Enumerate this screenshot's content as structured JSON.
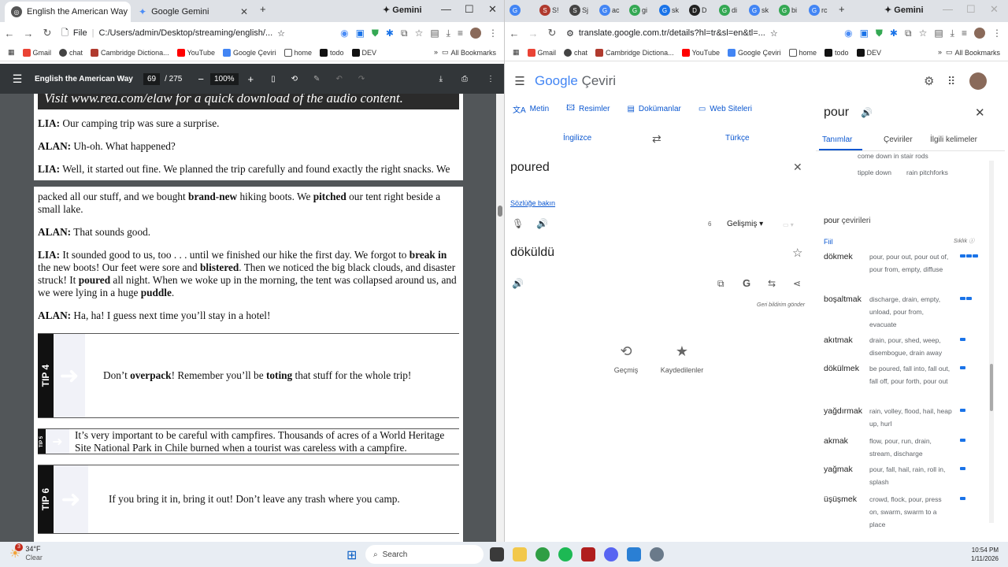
{
  "left_window": {
    "tabs": [
      {
        "label": "English the American Way",
        "active": true
      },
      {
        "label": "Google Gemini",
        "active": false
      }
    ],
    "gemini_label": "Gemini",
    "address": {
      "scheme": "File",
      "url": "C:/Users/admin/Desktop/streaming/english/..."
    },
    "bookmarks": [
      "Gmail",
      "chat",
      "Cambridge Dictiona...",
      "YouTube",
      "Google Çeviri",
      "home",
      "todo",
      "DEV"
    ],
    "all_bookmarks": "All Bookmarks",
    "pdf": {
      "title": "English the American Way",
      "page": "69",
      "total": "/ 275",
      "zoom": "100%",
      "header_strip": "Visit www.rea.com/elaw for a quick download of the audio content.",
      "top_lines": [
        {
          "speaker": "LIA:",
          "text": " Our camping trip was sure a surprise."
        },
        {
          "speaker": "ALAN:",
          "text": " Uh-oh. What happened?"
        },
        {
          "speaker": "LIA:",
          "text": " Well, it started out fine. We planned the trip carefully and found exactly the right snacks. We"
        }
      ],
      "para1": {
        "a": "packed all our stuff, and we bought ",
        "b1": "brand-new",
        "c": " hiking boots. We ",
        "b2": "pitched",
        "d": " our tent right beside a small lake."
      },
      "alan2": {
        "speaker": "ALAN:",
        "text": " That sounds good."
      },
      "para2": {
        "speaker": "LIA:",
        "a": " It sounded good to us, too . . . until we finished our hike the first day. We forgot to ",
        "b1": "break in",
        "c": " the new boots! Our feet were sore and ",
        "b2": "blistered",
        "d": ". Then we noticed the big black clouds, and disaster struck! It ",
        "b3": "poured",
        "e": " all night. When we woke up in the morning, the tent was collapsed around us, and we were lying in a huge ",
        "b4": "puddle",
        "f": "."
      },
      "alan3": {
        "speaker": "ALAN:",
        "text": " Ha, ha! I guess next time you’ll stay in a hotel!"
      },
      "tip4": {
        "label": "TIP 4",
        "a": "Don’t ",
        "b1": "overpack",
        "c": "! Remember you’ll be ",
        "b2": "toting",
        "d": " that stuff for the whole trip!"
      },
      "tip5": {
        "label": "TIP 5",
        "text": "It’s very important to be careful with campfires. Thousands of acres of a World Heritage Site National Park in Chile burned when a tourist was careless with a campfire."
      },
      "tip6": {
        "label": "TIP 6",
        "text": "If you bring it in, bring it out! Don’t leave any trash where you camp."
      }
    }
  },
  "right_window": {
    "tab_letters": [
      "G",
      "S",
      "S",
      "G",
      "G",
      "G",
      "D",
      "G",
      "G",
      "G",
      "G"
    ],
    "tab_abbrevs": [
      "",
      "S!",
      "Sj",
      "ac",
      "gi",
      "sk",
      "D",
      "di",
      "sk",
      "bi",
      "rc"
    ],
    "gemini_label": "Gemini",
    "address": {
      "url": "translate.google.com.tr/details?hl=tr&sl=en&tl=..."
    },
    "bookmarks": [
      "Gmail",
      "chat",
      "Cambridge Dictiona...",
      "YouTube",
      "Google Çeviri",
      "home",
      "todo",
      "DEV"
    ],
    "all_bookmarks": "All Bookmarks",
    "translate": {
      "logo_google": "Google",
      "logo_ceviri": "Çeviri",
      "modes": [
        "Metin",
        "Resimler",
        "Dokümanlar",
        "Web Siteleri"
      ],
      "source_lang": "İngilizce",
      "target_lang": "Türkçe",
      "source_text": "poured",
      "dictionary_link": "Sözlüğe bakın",
      "char_count": "6",
      "advanced": "Gelişmiş",
      "target_text": "döküldü",
      "feedback": "Geri bildirim gönder",
      "history": "Geçmiş",
      "saved": "Kaydedilenler"
    },
    "side": {
      "word": "pour",
      "tabs": [
        "Tanımlar",
        "Çeviriler",
        "İlgili kelimeler"
      ],
      "related_row1": "come down in stair rods",
      "related_row2a": "tipple down",
      "related_row2b": "rain pitchforks",
      "translations_title_word": "pour",
      "translations_title_rest": " çevirileri",
      "pos": "Fiil",
      "freq_label": "Sıklık",
      "entries": [
        {
          "word": "dökmek",
          "syn": "pour, pour out, pour out of, pour from, empty, diffuse",
          "freq": 3
        },
        {
          "word": "boşaltmak",
          "syn": "discharge, drain, empty, unload, pour from, evacuate",
          "freq": 2
        },
        {
          "word": "akıtmak",
          "syn": "drain, pour, shed, weep, disembogue, drain away",
          "freq": 1
        },
        {
          "word": "dökülmek",
          "syn": "be poured, fall into, fall out, fall off, pour forth, pour out",
          "freq": 1
        },
        {
          "word": "yağdırmak",
          "syn": "rain, volley, flood, hail, heap up, hurl",
          "freq": 1
        },
        {
          "word": "akmak",
          "syn": "flow, pour, run, drain, stream, discharge",
          "freq": 1
        },
        {
          "word": "yağmak",
          "syn": "pour, fall, hail, rain, roll in, splash",
          "freq": 1
        },
        {
          "word": "üşüşmek",
          "syn": "crowd, flock, pour, press on, swarm, swarm to a place",
          "freq": 1
        }
      ]
    }
  },
  "taskbar": {
    "weather_temp": "34°F",
    "weather_desc": "Clear",
    "weather_badge": "3",
    "search": "Search",
    "time": "10:54 PM",
    "date": "1/11/2026"
  }
}
